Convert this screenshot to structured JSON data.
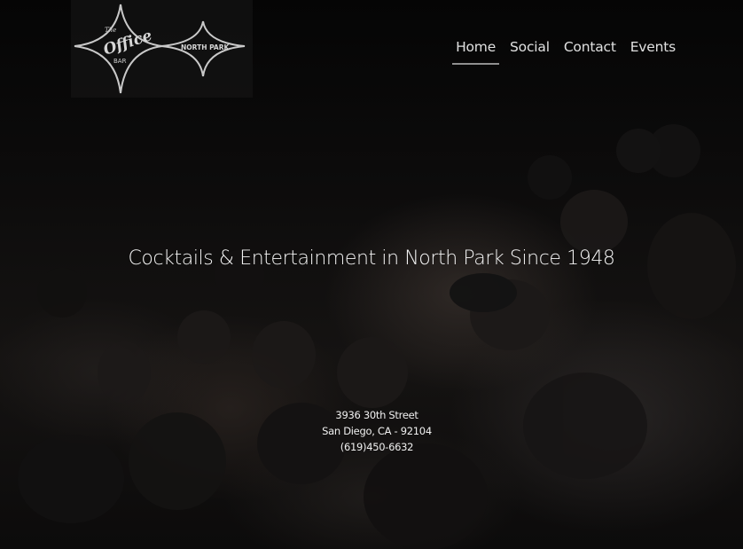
{
  "logo": {
    "text_the": "The",
    "text_office": "Office",
    "text_bar": "BAR",
    "text_location": "NORTH PARK"
  },
  "nav": {
    "items": [
      {
        "label": "Home",
        "active": true
      },
      {
        "label": "Social",
        "active": false
      },
      {
        "label": "Contact",
        "active": false
      },
      {
        "label": "Events",
        "active": false
      }
    ]
  },
  "hero": {
    "tagline": "Cocktails & Entertainment in North Park Since 1948"
  },
  "address": {
    "street": "3936 30th Street",
    "city": "San Diego, CA - 92104",
    "phone": "(619)450-6632"
  },
  "colors": {
    "background": "#070707",
    "text": "#f4f4f4",
    "nav_underline": "#8f8f8f"
  }
}
